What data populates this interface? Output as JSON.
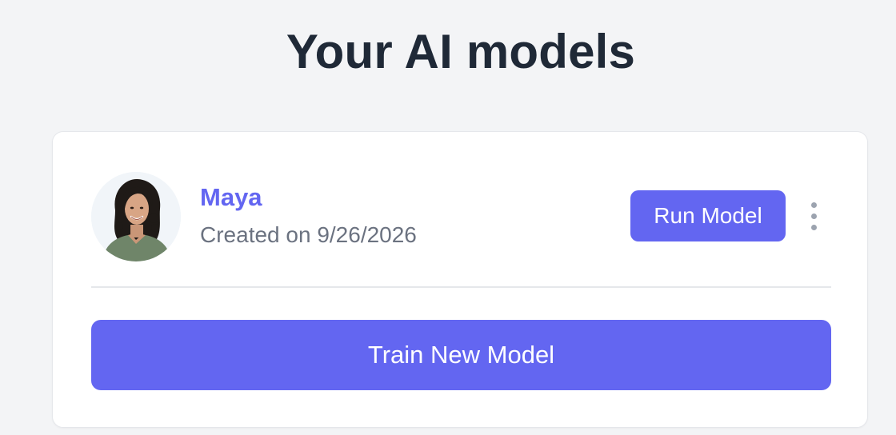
{
  "page": {
    "title": "Your AI models"
  },
  "models": [
    {
      "name": "Maya",
      "created": "Created on 9/26/2026",
      "run_label": "Run Model",
      "menu_icon": "kebab-vertical-icon"
    }
  ],
  "actions": {
    "train_label": "Train New Model"
  },
  "colors": {
    "background": "#f3f4f6",
    "accent": "#6366f1",
    "title": "#1f2937",
    "muted_text": "#6b7280",
    "card": "#ffffff",
    "divider": "#e5e7eb"
  }
}
